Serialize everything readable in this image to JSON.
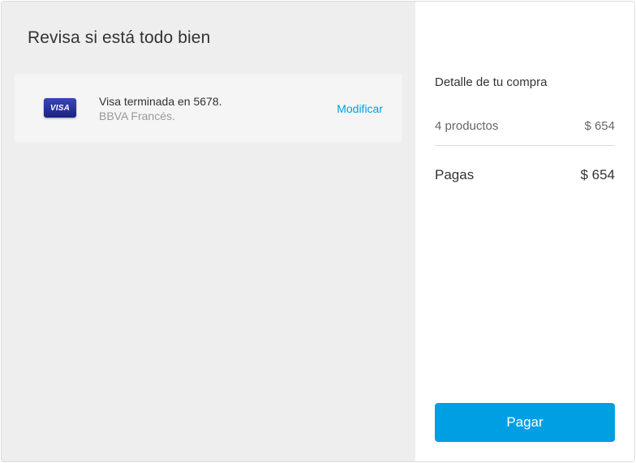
{
  "review": {
    "title": "Revisa si está todo bien",
    "payment_method": {
      "brand_logo_text": "VISA",
      "description": "Visa terminada en 5678.",
      "bank": "BBVA Francés.",
      "modify_label": "Modificar"
    }
  },
  "summary": {
    "title": "Detalle de tu compra",
    "items_label": "4 productos",
    "items_amount": "$ 654",
    "total_label": "Pagas",
    "total_amount": "$ 654",
    "pay_button_label": "Pagar"
  },
  "colors": {
    "accent": "#009ee3",
    "left_background": "#eeeeee",
    "card_background": "#f5f5f5"
  }
}
